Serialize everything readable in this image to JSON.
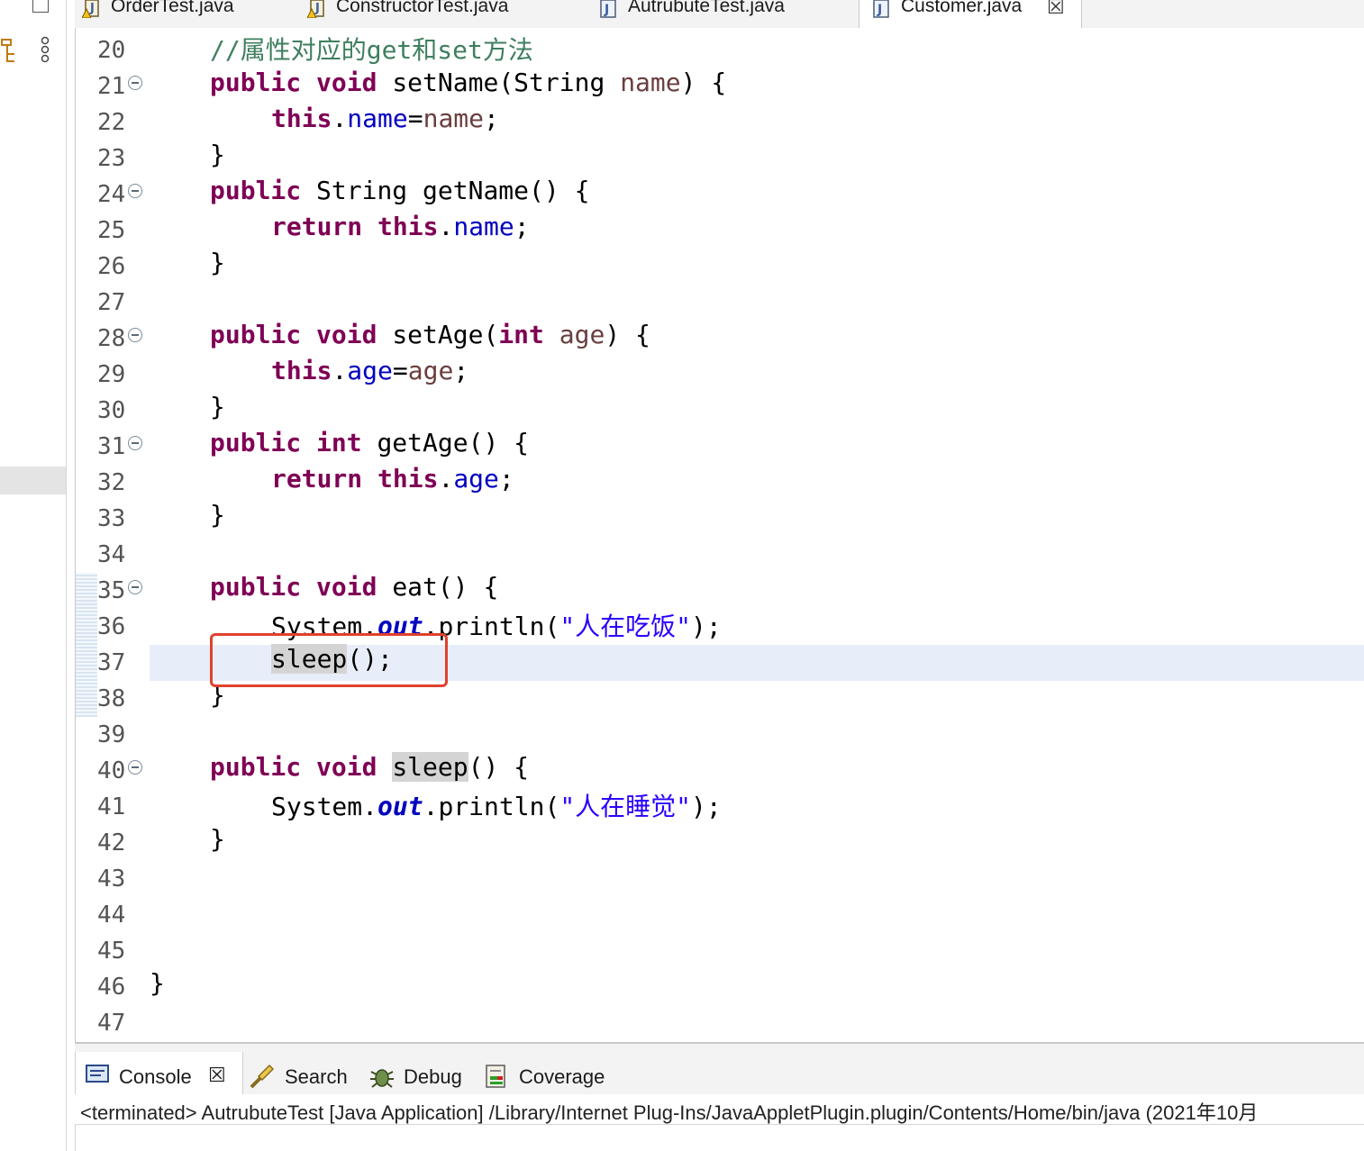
{
  "tabs": [
    {
      "label": "OrderTest.java",
      "icon": "java-file-warning-icon"
    },
    {
      "label": "ConstructorTest.java",
      "icon": "java-file-warning-icon"
    },
    {
      "label": "AutrubuteTest.java",
      "icon": "java-file-icon"
    },
    {
      "label": "Customer.java",
      "icon": "java-file-icon",
      "active": true
    }
  ],
  "tab_close": "☒",
  "line_numbers": [
    "20",
    "21",
    "22",
    "23",
    "24",
    "25",
    "26",
    "27",
    "28",
    "29",
    "30",
    "31",
    "32",
    "33",
    "34",
    "35",
    "36",
    "37",
    "38",
    "39",
    "40",
    "41",
    "42",
    "43",
    "44",
    "45",
    "46",
    "47"
  ],
  "code": {
    "l20": "//属性对应的get和set方法",
    "kw_public": "public",
    "kw_void": "void",
    "kw_this": "this",
    "kw_return": "return",
    "kw_int": "int",
    "setName": "setName(",
    "String": "String ",
    "p_name": "name",
    "brace_close_paren": ") {",
    "dot": ".",
    "f_name": "name",
    "eq": "=",
    "semi": ";",
    "rbrace": "}",
    "getName_sig": " String getName() {",
    "setAge": "setAge(",
    "p_age": "age",
    "f_age": "age",
    "getAge_sig": "getAge() {",
    "eat_sig": "eat() {",
    "system": "System.",
    "out": "out",
    "println": ".println(",
    "str_eat": "\"人在吃饭\"",
    "str_sleep": "\"人在睡觉\"",
    "close_call": ");",
    "sleep": "sleep",
    "sleep_call_rest": "();",
    "sleep_decl_rest": "() {"
  },
  "bottom_tabs": {
    "console": "Console",
    "search": "Search",
    "debug": "Debug",
    "coverage": "Coverage"
  },
  "status": "<terminated> AutrubuteTest [Java Application] /Library/Internet Plug-Ins/JavaAppletPlugin.plugin/Contents/Home/bin/java  (2021年10月"
}
